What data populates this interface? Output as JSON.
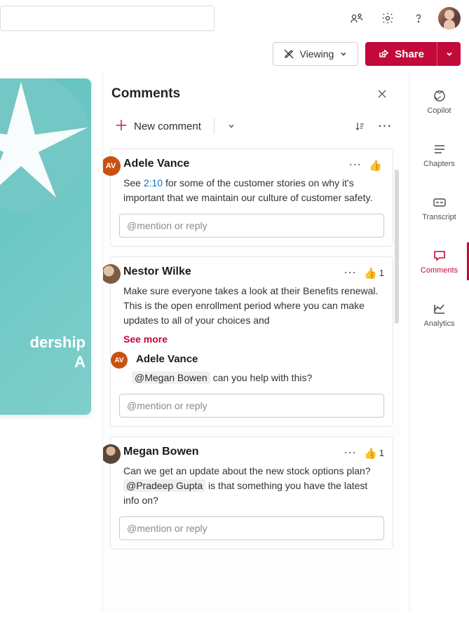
{
  "topbar": {
    "viewing_label": "Viewing",
    "share_label": "Share"
  },
  "preview": {
    "title_line1": "dership",
    "title_line2": "A"
  },
  "comments_panel": {
    "title": "Comments",
    "new_comment_label": "New comment",
    "reply_placeholder": "@mention or reply"
  },
  "comments": [
    {
      "author": "Adele Vance",
      "avatar_type": "initials",
      "initials": "AV",
      "avatar_class": "av-orange",
      "body_prefix": "See ",
      "time_link": "2:10",
      "body_suffix": " for some of the customer stories on why it's important that we maintain our culture of customer safety.",
      "like_count": ""
    },
    {
      "author": "Nestor Wilke",
      "avatar_type": "photo",
      "avatar_class": "av-photo1",
      "body": "Make sure everyone takes a look at their Benefits renewal. This is the open enrollment period where you can make updates to all of your choices and",
      "see_more": "See more",
      "like_count": "1",
      "reply": {
        "author": "Adele Vance",
        "initials": "AV",
        "avatar_class": "av-orange",
        "mention": "@Megan Bowen",
        "body_suffix": " can you help with this?"
      }
    },
    {
      "author": "Megan Bowen",
      "avatar_type": "photo",
      "avatar_class": "av-photo2",
      "body_prefix": "Can we get an update about the new stock options plan? ",
      "mention": "@Pradeep Gupta",
      "body_suffix": " is that something you have the latest info on?",
      "like_count": "1"
    }
  ],
  "rail": {
    "copilot": "Copilot",
    "chapters": "Chapters",
    "transcript": "Transcript",
    "comments": "Comments",
    "analytics": "Analytics"
  }
}
